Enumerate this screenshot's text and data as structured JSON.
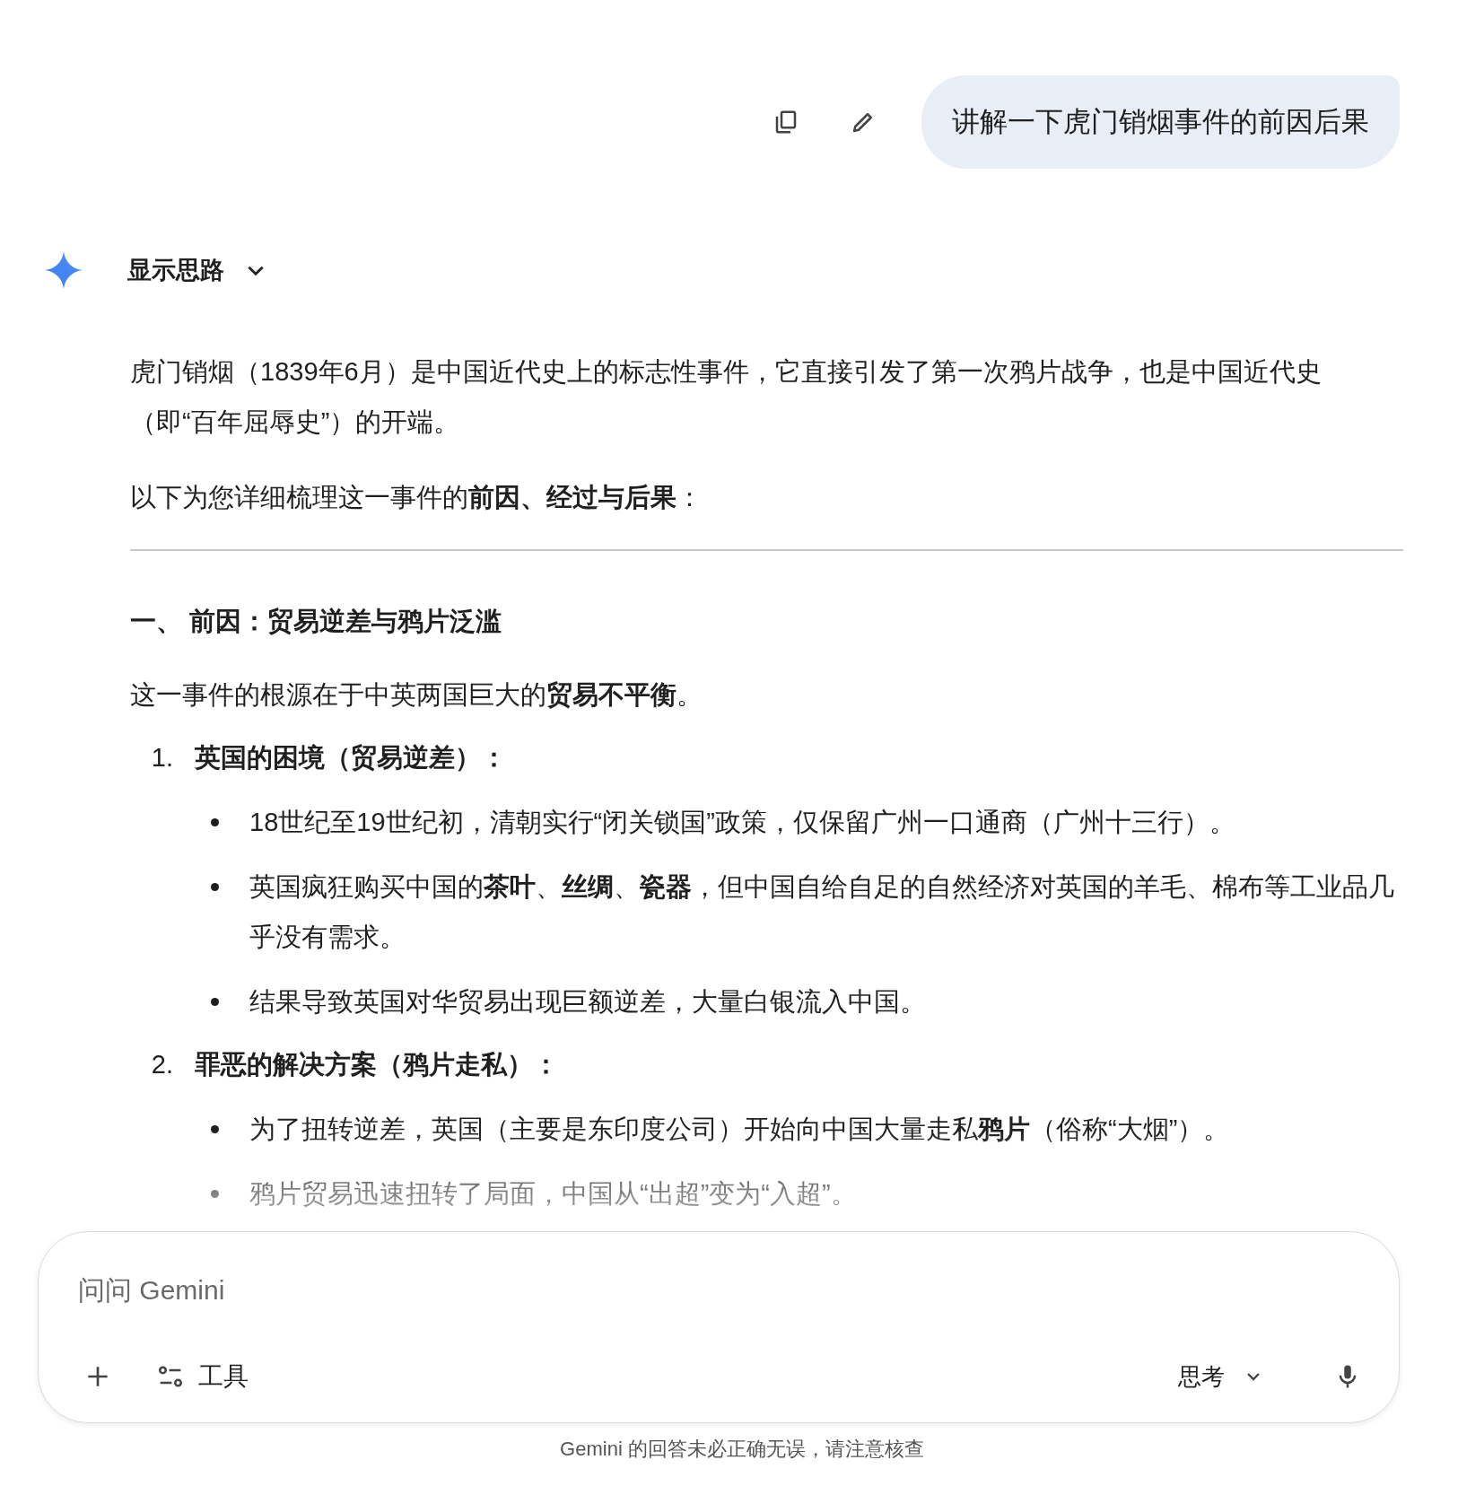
{
  "user_message": {
    "text": "讲解一下虎门销烟事件的前因后果"
  },
  "response": {
    "thoughts_toggle": {
      "label": "显示思路",
      "expanded": false
    },
    "intro": [
      "虎门销烟（1839年6月）是中国近代史上的标志性事件，它直接引发了第一次鸦片战争，也是中国近代史（即“百年屈辱史”）的开端。",
      "以下为您详细梳理这一事件的**前因、经过与后果**："
    ],
    "sections": [
      {
        "heading": "一、 前因：贸易逆差与鸦片泛滥",
        "lead": "这一事件的根源在于中英两国巨大的**贸易不平衡**。",
        "items": [
          {
            "number": "1.",
            "title": "英国的困境（贸易逆差）：",
            "bullets": [
              "18世纪至19世纪初，清朝实行“闭关锁国”政策，仅保留广州一口通商（广州十三行）。",
              "英国疯狂购买中国的**茶叶**、**丝绸**、**瓷器**，但中国自给自足的自然经济对英国的羊毛、棉布等工业品几乎没有需求。",
              "结果导致英国对华贸易出现巨额逆差，大量白银流入中国。"
            ]
          },
          {
            "number": "2.",
            "title": "罪恶的解决方案（鸦片走私）：",
            "bullets": [
              "为了扭转逆差，英国（主要是东印度公司）开始向中国大量走私**鸦片**（俗称“大烟”）。",
              "鸦片贸易迅速扭转了局面，中国从“出超”变为“入超”。"
            ]
          }
        ]
      }
    ]
  },
  "composer": {
    "placeholder": "问问 Gemini",
    "tools_label": "工具",
    "mode_label": "思考"
  },
  "disclaimer": "Gemini 的回答未必正确无误，请注意核查"
}
